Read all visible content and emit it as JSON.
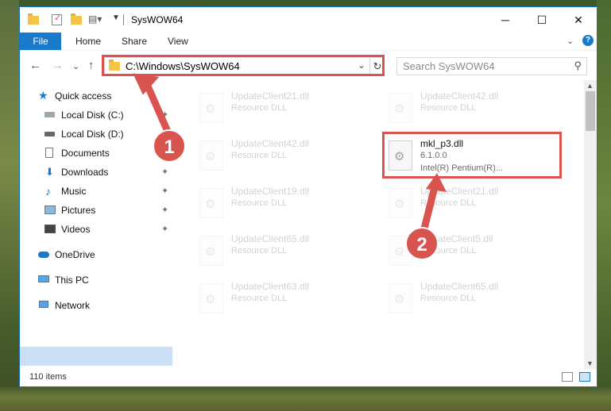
{
  "window": {
    "title": "SysWOW64",
    "controls": {
      "minimize": "─",
      "maximize": "☐",
      "close": "✕"
    }
  },
  "ribbon": {
    "tabs": [
      "File",
      "Home",
      "Share",
      "View"
    ],
    "expand_glyph": "⌄",
    "help_glyph": "?"
  },
  "navigation": {
    "back_glyph": "←",
    "forward_glyph": "→",
    "recent_glyph": "⌄",
    "up_glyph": "↑",
    "address": "C:\\Windows\\SysWOW64",
    "address_dropdown_glyph": "⌄",
    "refresh_glyph": "↻",
    "search_placeholder": "Search SysWOW64",
    "search_glyph": "⚲"
  },
  "sidebar": {
    "items": [
      {
        "label": "Quick access",
        "icon": "star-icon",
        "pinned": false
      },
      {
        "label": "Local Disk (C:)",
        "icon": "drive-icon",
        "pinned": true
      },
      {
        "label": "Local Disk (D:)",
        "icon": "drive-icon",
        "pinned": true
      },
      {
        "label": "Documents",
        "icon": "document-icon",
        "pinned": true
      },
      {
        "label": "Downloads",
        "icon": "download-icon",
        "pinned": true
      },
      {
        "label": "Music",
        "icon": "music-icon",
        "pinned": true
      },
      {
        "label": "Pictures",
        "icon": "picture-icon",
        "pinned": true
      },
      {
        "label": "Videos",
        "icon": "video-icon",
        "pinned": true
      },
      {
        "label": "OneDrive",
        "icon": "cloud-icon",
        "pinned": false
      },
      {
        "label": "This PC",
        "icon": "computer-icon",
        "pinned": false,
        "selected": true
      },
      {
        "label": "Network",
        "icon": "network-icon",
        "pinned": false
      }
    ],
    "pin_glyph": "📌"
  },
  "files": {
    "left_column": [
      {
        "name": "UpdateClient21.dll",
        "type": "Resource DLL"
      },
      {
        "name": "UpdateClient42.dll",
        "type": "Resource DLL"
      },
      {
        "name": "UpdateClient19.dll",
        "type": "Resource DLL"
      },
      {
        "name": "UpdateClient65.dll",
        "type": "Resource DLL"
      },
      {
        "name": "UpdateClient63.dll",
        "type": "Resource DLL"
      }
    ],
    "right_column": [
      {
        "name": "UpdateClient42.dll",
        "type": "Resource DLL"
      },
      {
        "name": "mkl_p3.dll",
        "version": "6.1.0.0",
        "company": "Intel(R) Pentium(R)...",
        "selected": true
      },
      {
        "name": "UpdateClient21.dll",
        "type": "Resource DLL"
      },
      {
        "name": "UpdateClient5.dll",
        "type": "Resource DLL"
      },
      {
        "name": "UpdateClient65.dll",
        "type": "Resource DLL"
      }
    ]
  },
  "status": {
    "item_count": "110 items"
  },
  "annotations": {
    "step1": "1",
    "step2": "2",
    "highlight_color": "#d9534f"
  },
  "colors": {
    "accent": "#1979ca",
    "selection": "#cce0f5"
  }
}
